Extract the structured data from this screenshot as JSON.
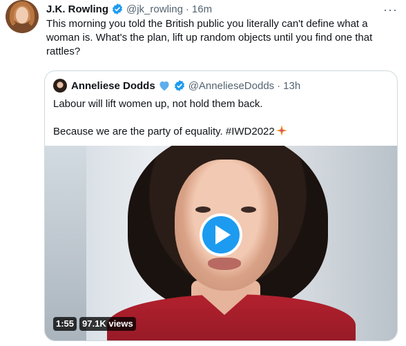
{
  "tweet": {
    "author_name": "J.K. Rowling",
    "handle": "@jk_rowling",
    "separator": "·",
    "time": "16m",
    "text": "This morning you told the British public you literally can't define what a woman is. What's the plan, lift up random objects until you find one that rattles?",
    "more_icon": "more-horizontal-icon",
    "verified_icon": "verified-badge-icon"
  },
  "quote": {
    "author_name": "Anneliese Dodds",
    "emoji": "blue-heart-icon",
    "handle": "@AnnelieseDodds",
    "separator": "·",
    "time": "13h",
    "line1": "Labour will lift women up, not hold them back.",
    "line2": "Because we are the party of equality. #IWD2022",
    "sparkle_icon": "sparkle-emoji-icon",
    "video": {
      "duration": "1:55",
      "views": "97.1K views",
      "play_icon": "play-icon"
    }
  },
  "colors": {
    "accent": "#1d9bf0",
    "secondary_text": "#536471",
    "border": "#cfd9de"
  }
}
